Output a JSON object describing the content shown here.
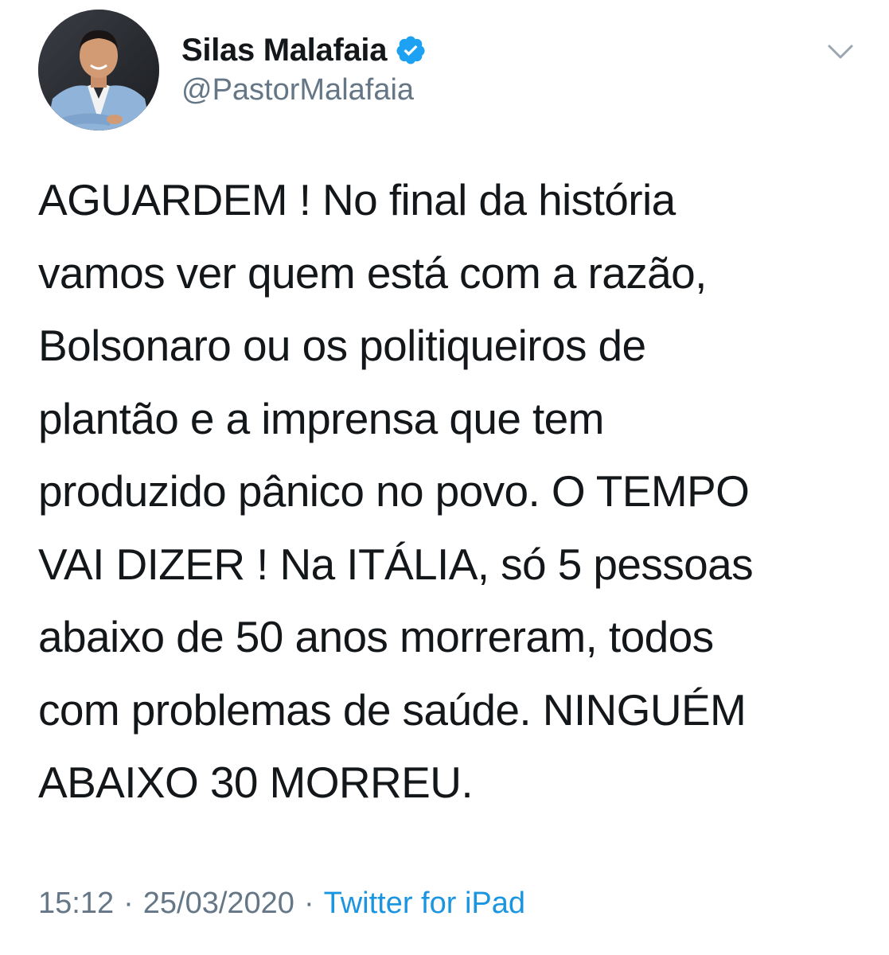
{
  "tweet": {
    "author": {
      "display_name": "Silas Malafaia",
      "handle": "@PastorMalafaia",
      "verified": true,
      "avatar_icon": "profile-photo"
    },
    "text": "AGUARDEM ! No final da história\nvamos ver quem está com a razão,\nBolsonaro ou os politiqueiros de\nplantão e a imprensa que tem\nproduzido pânico no povo. O TEMPO\nVAI DIZER ! Na ITÁLIA, só 5 pessoas\nabaixo de 50 anos morreram, todos\ncom problemas de saúde. NINGUÉM\nABAIXO 30 MORREU.",
    "time": "15:12",
    "separator": "·",
    "date": "25/03/2020",
    "source": "Twitter for iPad"
  },
  "colors": {
    "text": "#14171a",
    "secondary": "#657786",
    "link": "#1b95e0",
    "verified": "#1da1f2"
  },
  "icons": {
    "verified": "verified-badge-icon",
    "menu": "chevron-down-icon"
  }
}
